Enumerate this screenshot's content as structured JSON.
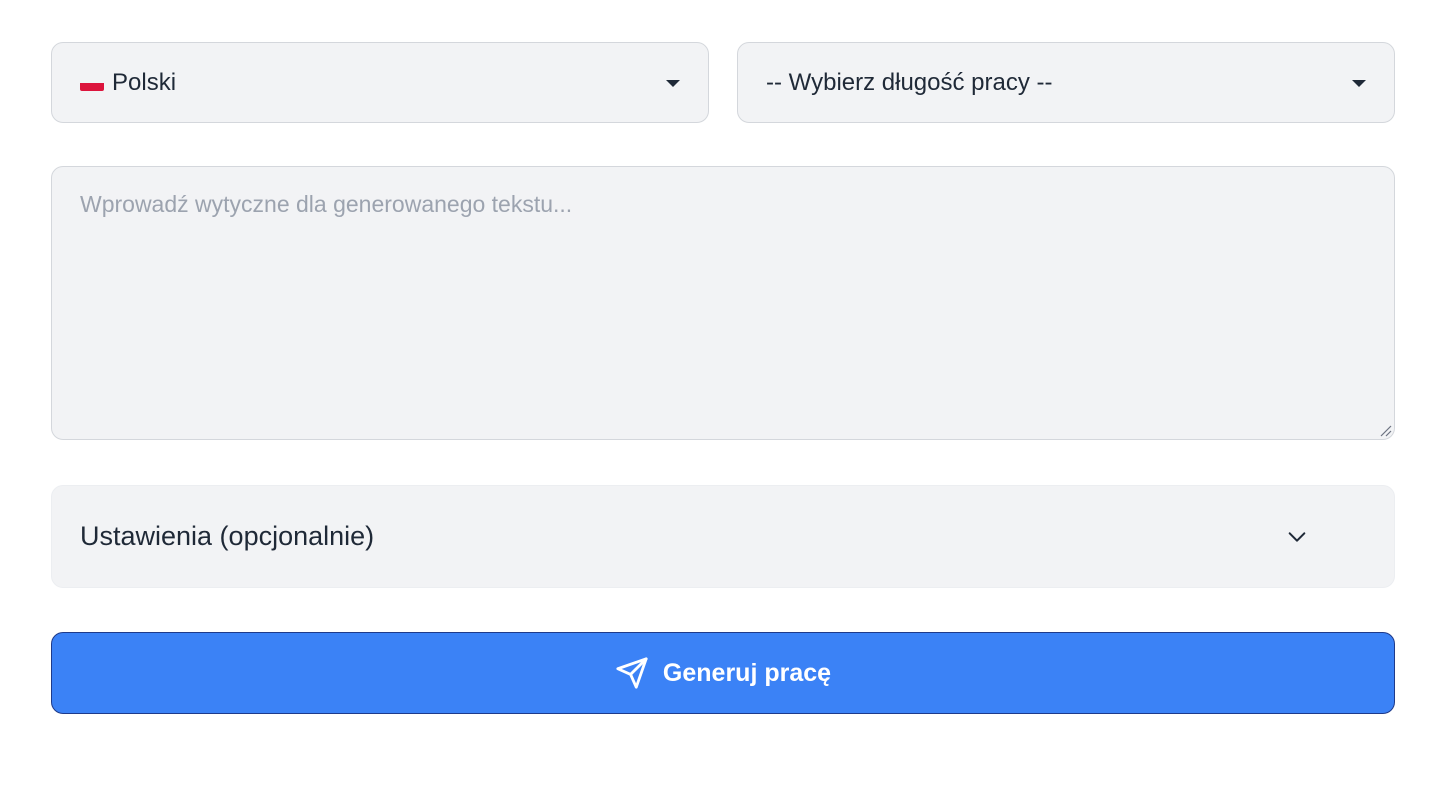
{
  "language_select": {
    "selected_label": "Polski",
    "flag_icon": "poland-flag-icon"
  },
  "length_select": {
    "selected_label": "-- Wybierz długość pracy --"
  },
  "guidelines": {
    "value": "",
    "placeholder": "Wprowadź wytyczne dla generowanego tekstu..."
  },
  "settings_panel": {
    "label": "Ustawienia (opcjonalnie)",
    "icon": "chevron-down-icon",
    "expanded": false
  },
  "generate_button": {
    "label": "Generuj pracę",
    "icon": "send-icon"
  },
  "colors": {
    "accent": "#3b82f6",
    "field_background": "#f2f3f5",
    "text": "#1f2937",
    "placeholder": "#9ca3af",
    "flag_red": "#dc143c"
  }
}
